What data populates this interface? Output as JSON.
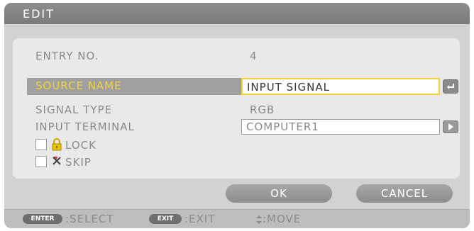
{
  "dialog": {
    "title": "EDIT"
  },
  "form": {
    "entry_no_label": "ENTRY NO.",
    "entry_no_value": "4",
    "source_name_label": "SOURCE NAME",
    "source_name_value": "INPUT SIGNAL",
    "signal_type_label": "SIGNAL TYPE",
    "signal_type_value": "RGB",
    "input_terminal_label": "INPUT TERMINAL",
    "input_terminal_value": "COMPUTER1",
    "lock_label": "LOCK",
    "skip_label": "SKIP",
    "lock_checked": false,
    "skip_checked": false
  },
  "buttons": {
    "ok": "OK",
    "cancel": "CANCEL"
  },
  "footer": {
    "enter_key": "ENTER",
    "enter_action": ":SELECT",
    "exit_key": "EXIT",
    "exit_action": ":EXIT",
    "move_action": ":MOVE"
  },
  "colors": {
    "highlight_text": "#f3d33a",
    "highlight_bg": "#a0a0a0",
    "button_bg": "#9a9a9a"
  },
  "icons": {
    "lock": "lock-icon",
    "skip": "skip-icon",
    "enter": "enter-icon",
    "dropdown": "arrow-right-icon",
    "move": "move-arrows-icon"
  }
}
